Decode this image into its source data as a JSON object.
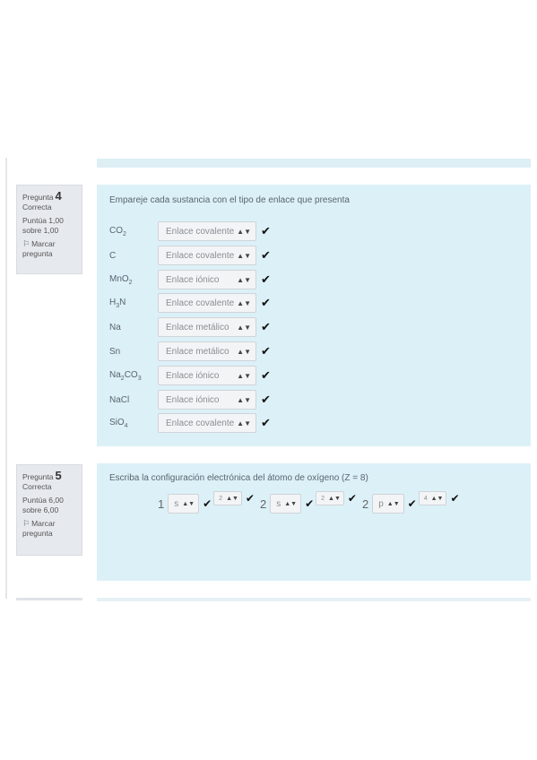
{
  "q4": {
    "label": "Pregunta",
    "number": "4",
    "status": "Correcta",
    "score_line1": "Puntúa 1,00",
    "score_line2": "sobre 1,00",
    "flag_line1": "Marcar",
    "flag_line2": "pregunta",
    "prompt": "Empareje cada sustancia con el tipo de enlace que presenta",
    "rows": [
      {
        "base": "CO",
        "sub": "2",
        "tail": "",
        "answer": "Enlace covalente"
      },
      {
        "base": "C",
        "sub": "",
        "tail": "",
        "answer": "Enlace covalente"
      },
      {
        "base": "MnO",
        "sub": "2",
        "tail": "",
        "answer": "Enlace iónico"
      },
      {
        "base": "H",
        "sub": "3",
        "tail": "N",
        "answer": "Enlace covalente"
      },
      {
        "base": "Na",
        "sub": "",
        "tail": "",
        "answer": "Enlace metálico"
      },
      {
        "base": "Sn",
        "sub": "",
        "tail": "",
        "answer": "Enlace metálico"
      },
      {
        "base": "Na",
        "sub": "2",
        "tail": "CO",
        "sub2": "3",
        "answer": "Enlace iónico"
      },
      {
        "base": "NaCl",
        "sub": "",
        "tail": "",
        "answer": "Enlace iónico"
      },
      {
        "base": "SiO",
        "sub": "4",
        "tail": "",
        "answer": "Enlace covalente"
      }
    ]
  },
  "q5": {
    "label": "Pregunta",
    "number": "5",
    "status": "Correcta",
    "score_line1": "Puntúa 6,00",
    "score_line2": "sobre 6,00",
    "flag_line1": "Marcar",
    "flag_line2": "pregunta",
    "prompt": "Escriba la configuración electrónica del átomo de oxígeno (Z = 8)",
    "config": {
      "n1": "1",
      "l1": "s",
      "e1": "2",
      "n2": "2",
      "l2": "s",
      "e2": "2",
      "n3": "2",
      "l3": "p",
      "e3": "4"
    }
  },
  "icons": {
    "check": "check-icon",
    "flag": "flag-icon",
    "select_arrow": "updown-arrow-icon"
  },
  "colors": {
    "content_bg": "#dcf0f7",
    "info_bg": "#e6e9ee",
    "check": "#111111"
  }
}
